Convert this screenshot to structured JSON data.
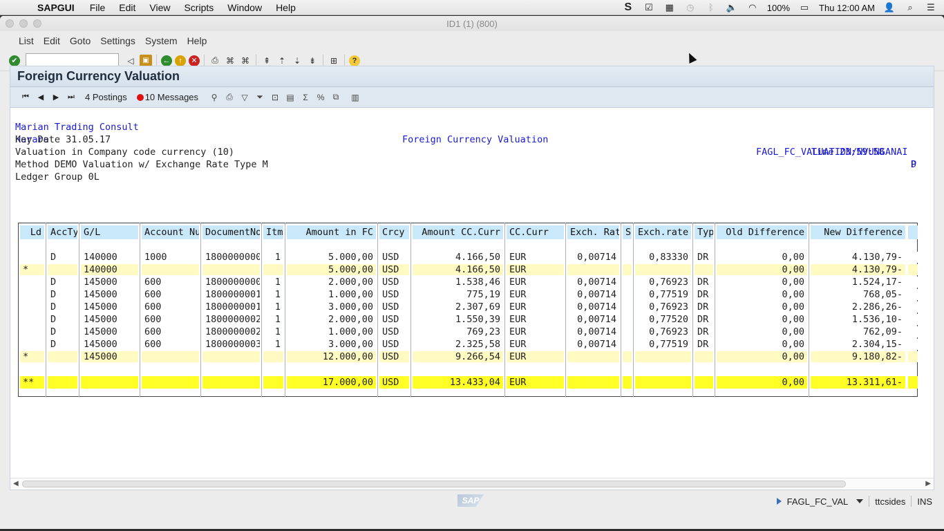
{
  "os_menubar": {
    "apple": "",
    "app": "SAPGUI",
    "items": [
      "File",
      "Edit",
      "View",
      "Scripts",
      "Window",
      "Help"
    ],
    "battery": "100%",
    "clock": "Thu 12:00 AM"
  },
  "window": {
    "title": "ID1 (1) (800)"
  },
  "sap_menu": {
    "items": [
      "List",
      "Edit",
      "Goto",
      "Settings",
      "System",
      "Help"
    ]
  },
  "toolbar": {
    "command_value": ""
  },
  "page": {
    "title": "Foreign Currency Valuation"
  },
  "app_toolbar": {
    "postings": "4 Postings",
    "messages": "10 Messages"
  },
  "report_header": {
    "company": "Marian Trading Consult",
    "city": "Harare",
    "center_title": "Foreign Currency Valuation",
    "time": "Time 23:59:58",
    "time_suffix": "D",
    "program": "FAGL_FC_VALUATION/NVUNGANAI",
    "program_suffix": "P",
    "key_date": "Key Date 31.05.17",
    "valuation": "Valuation in Company code currency (10)",
    "method": "Method DEMO Valuation w/ Exchange Rate Type M",
    "ledger": "Ledger Group 0L"
  },
  "grid": {
    "columns": [
      "Ld",
      "AccTy",
      "G/L",
      "Account Nu",
      "DocumentNo",
      "Itm",
      "Amount in FC",
      "Crcy",
      "Amount CC.Curr",
      "CC.Curr",
      "Exch. Rat",
      "S",
      "Exch.rate",
      "Typ",
      "Old Difference",
      "New Difference"
    ],
    "rows": [
      {
        "type": "row",
        "cells": [
          "",
          "D",
          "140000",
          "1000",
          "1800000000",
          "1",
          "5.000,00",
          "USD",
          "4.166,50",
          "EUR",
          "0,00714",
          "",
          "0,83330",
          "DR",
          "0,00",
          "4.130,79-"
        ]
      },
      {
        "type": "sub",
        "cells": [
          "*",
          "",
          "140000",
          "",
          "",
          "",
          "5.000,00",
          "USD",
          "4.166,50",
          "EUR",
          "",
          "",
          "",
          "",
          "0,00",
          "4.130,79-"
        ]
      },
      {
        "type": "row",
        "cells": [
          "",
          "D",
          "145000",
          "600",
          "1800000000",
          "1",
          "2.000,00",
          "USD",
          "1.538,46",
          "EUR",
          "0,00714",
          "",
          "0,76923",
          "DR",
          "0,00",
          "1.524,17-"
        ]
      },
      {
        "type": "row",
        "cells": [
          "",
          "D",
          "145000",
          "600",
          "1800000001",
          "1",
          "1.000,00",
          "USD",
          "775,19",
          "EUR",
          "0,00714",
          "",
          "0,77519",
          "DR",
          "0,00",
          "768,05-"
        ]
      },
      {
        "type": "row",
        "cells": [
          "",
          "D",
          "145000",
          "600",
          "1800000001",
          "1",
          "3.000,00",
          "USD",
          "2.307,69",
          "EUR",
          "0,00714",
          "",
          "0,76923",
          "DR",
          "0,00",
          "2.286,26-"
        ]
      },
      {
        "type": "row",
        "cells": [
          "",
          "D",
          "145000",
          "600",
          "1800000002",
          "1",
          "2.000,00",
          "USD",
          "1.550,39",
          "EUR",
          "0,00714",
          "",
          "0,77520",
          "DR",
          "0,00",
          "1.536,10-"
        ]
      },
      {
        "type": "row",
        "cells": [
          "",
          "D",
          "145000",
          "600",
          "1800000002",
          "1",
          "1.000,00",
          "USD",
          "769,23",
          "EUR",
          "0,00714",
          "",
          "0,76923",
          "DR",
          "0,00",
          "762,09-"
        ]
      },
      {
        "type": "row",
        "cells": [
          "",
          "D",
          "145000",
          "600",
          "1800000003",
          "1",
          "3.000,00",
          "USD",
          "2.325,58",
          "EUR",
          "0,00714",
          "",
          "0,77519",
          "DR",
          "0,00",
          "2.304,15-"
        ]
      },
      {
        "type": "sub",
        "cells": [
          "*",
          "",
          "145000",
          "",
          "",
          "",
          "12.000,00",
          "USD",
          "9.266,54",
          "EUR",
          "",
          "",
          "",
          "",
          "0,00",
          "9.180,82-"
        ]
      },
      {
        "type": "tot",
        "cells": [
          "**",
          "",
          "",
          "",
          "",
          "",
          "17.000,00",
          "USD",
          "13.433,04",
          "EUR",
          "",
          "",
          "",
          "",
          "0,00",
          "13.311,61-"
        ]
      }
    ]
  },
  "statusbar": {
    "logo": "SAP",
    "transaction": "FAGL_FC_VAL",
    "host": "ttcsides",
    "mode": "INS"
  },
  "colors": {
    "header_cell": "#c9e9fb",
    "subtotal": "#fff9c2",
    "total": "#ffff27",
    "header_text": "#1a1ad0"
  }
}
